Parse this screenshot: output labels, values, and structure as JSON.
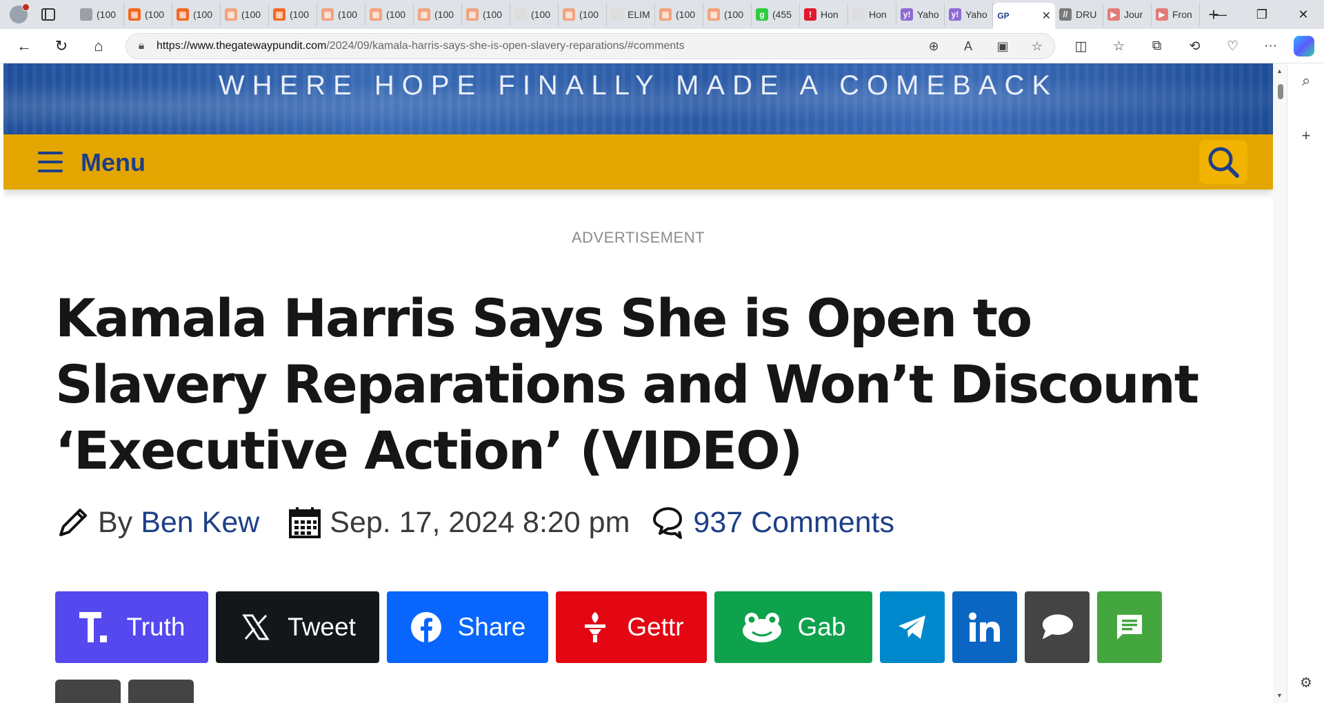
{
  "browser": {
    "tabs": [
      {
        "label": "(100",
        "fav": "#9aa0a6",
        "glyph": ""
      },
      {
        "label": "(100",
        "fav": "#f26822",
        "glyph": "▦"
      },
      {
        "label": "(100",
        "fav": "#f26822",
        "glyph": "▦"
      },
      {
        "label": "(100",
        "fav": "#f0a37e",
        "glyph": "▦"
      },
      {
        "label": "(100",
        "fav": "#f26822",
        "glyph": "▦"
      },
      {
        "label": "(100",
        "fav": "#f0a37e",
        "glyph": "▦"
      },
      {
        "label": "(100",
        "fav": "#f0a37e",
        "glyph": "▦"
      },
      {
        "label": "(100",
        "fav": "#f0a37e",
        "glyph": "▦"
      },
      {
        "label": "(100",
        "fav": "#f0a37e",
        "glyph": "▦"
      },
      {
        "label": "(100",
        "fav": "#dddddd",
        "glyph": ""
      },
      {
        "label": "(100",
        "fav": "#f0a37e",
        "glyph": "▦"
      },
      {
        "label": "ELIM",
        "fav": "#dddddd",
        "glyph": ""
      },
      {
        "label": "(100",
        "fav": "#f0a37e",
        "glyph": "▦"
      },
      {
        "label": "(100",
        "fav": "#f0a37e",
        "glyph": "▦"
      },
      {
        "label": "(455",
        "fav": "#2ecc40",
        "glyph": "g"
      },
      {
        "label": "Hon",
        "fav": "#e0192f",
        "glyph": "!"
      },
      {
        "label": "Hon",
        "fav": "#dddddd",
        "glyph": ""
      },
      {
        "label": "Yaho",
        "fav": "#8e6bd1",
        "glyph": "y!"
      },
      {
        "label": "Yaho",
        "fav": "#8e6bd1",
        "glyph": "y!"
      },
      {
        "label": "DRU",
        "fav": "#7a7a7a",
        "glyph": "//"
      },
      {
        "label": "Jour",
        "fav": "#e37b7b",
        "glyph": "▶"
      },
      {
        "label": "Fron",
        "fav": "#e37b7b",
        "glyph": "▶"
      }
    ],
    "active_tab": {
      "fav_text": "GP",
      "close": "✕"
    },
    "new_tab": "+",
    "url_host": "https://www.thegatewaypundit.com",
    "url_path": "/2024/09/kamala-harris-says-she-is-open-slavery-reparations/#comments"
  },
  "site": {
    "tagline": "WHERE HOPE FINALLY MADE A COMEBACK",
    "menu_label": "Menu",
    "brand_blue": "#1d3f87",
    "brand_gold": "#e3a600"
  },
  "article": {
    "advertisement": "ADVERTISEMENT",
    "headline": "Kamala Harris Says She is Open to Slavery Reparations and Won’t Discount ‘Executive Action’ (VIDEO)",
    "by": "By",
    "author": "Ben Kew",
    "date": "Sep. 17, 2024 8:20 pm",
    "comments": "937 Comments"
  },
  "share": [
    {
      "name": "share-truth-button",
      "label": "Truth",
      "color": "#5448ee",
      "icon": "truth-social-icon"
    },
    {
      "name": "share-tweet-button",
      "label": "Tweet",
      "color": "#14171a",
      "icon": "x-icon"
    },
    {
      "name": "share-facebook-button",
      "label": "Share",
      "color": "#0866ff",
      "icon": "facebook-icon"
    },
    {
      "name": "share-gettr-button",
      "label": "Gettr",
      "color": "#e30613",
      "icon": "gettr-icon"
    },
    {
      "name": "share-gab-button",
      "label": "Gab",
      "color": "#0fa24c",
      "icon": "gab-frog-icon"
    },
    {
      "name": "share-telegram-button",
      "label": "",
      "color": "#0088cc",
      "icon": "telegram-icon"
    },
    {
      "name": "share-linkedin-button",
      "label": "",
      "color": "#0a66c2",
      "icon": "linkedin-icon"
    },
    {
      "name": "share-comment-button",
      "label": "",
      "color": "#444444",
      "icon": "speech-bubble-icon"
    },
    {
      "name": "share-sms-button",
      "label": "",
      "color": "#44a63f",
      "icon": "sms-icon"
    }
  ]
}
